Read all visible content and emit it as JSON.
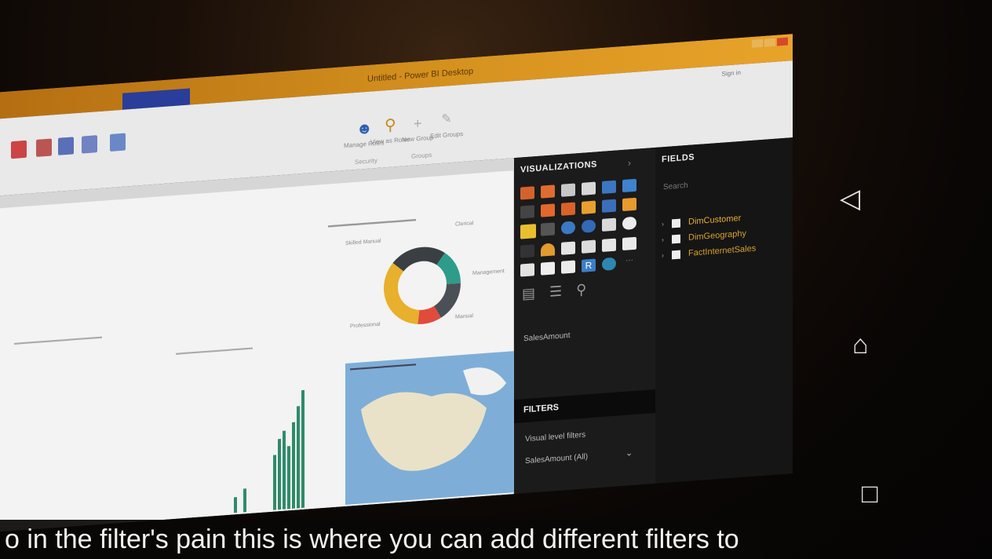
{
  "window": {
    "title": "Untitled - Power BI Desktop",
    "signin": "Sign in"
  },
  "ribbon": {
    "buttons": [
      {
        "label": "Manage Roles",
        "icon": "users-icon"
      },
      {
        "label": "View as Roles",
        "icon": "view-roles-icon"
      },
      {
        "label": "New Group",
        "icon": "plus-icon"
      },
      {
        "label": "Edit Groups",
        "icon": "pencil-icon"
      }
    ],
    "sections": [
      "Security",
      "Groups"
    ]
  },
  "report": {
    "donut_labels": [
      "Skilled Manual",
      "Clerical",
      "Management",
      "Manual",
      "Professional"
    ],
    "donut_colors": [
      "#3a3f44",
      "#2e9c8a",
      "#3d4349",
      "#e14b3b",
      "#e8b02c"
    ]
  },
  "visualizations_pane": {
    "header": "VISUALIZATIONS",
    "value_field": "SalesAmount",
    "filters_header": "FILTERS",
    "filter_items": [
      "Visual level filters",
      "SalesAmount (All)"
    ]
  },
  "fields_pane": {
    "header": "FIELDS",
    "search_placeholder": "Search",
    "tables": [
      "DimCustomer",
      "DimGeography",
      "FactInternetSales"
    ]
  },
  "caption": {
    "text": "o in the filter's pain this is where you can add different filters to"
  },
  "android_nav": {
    "icons": [
      "back-icon",
      "home-icon",
      "recents-icon"
    ]
  }
}
